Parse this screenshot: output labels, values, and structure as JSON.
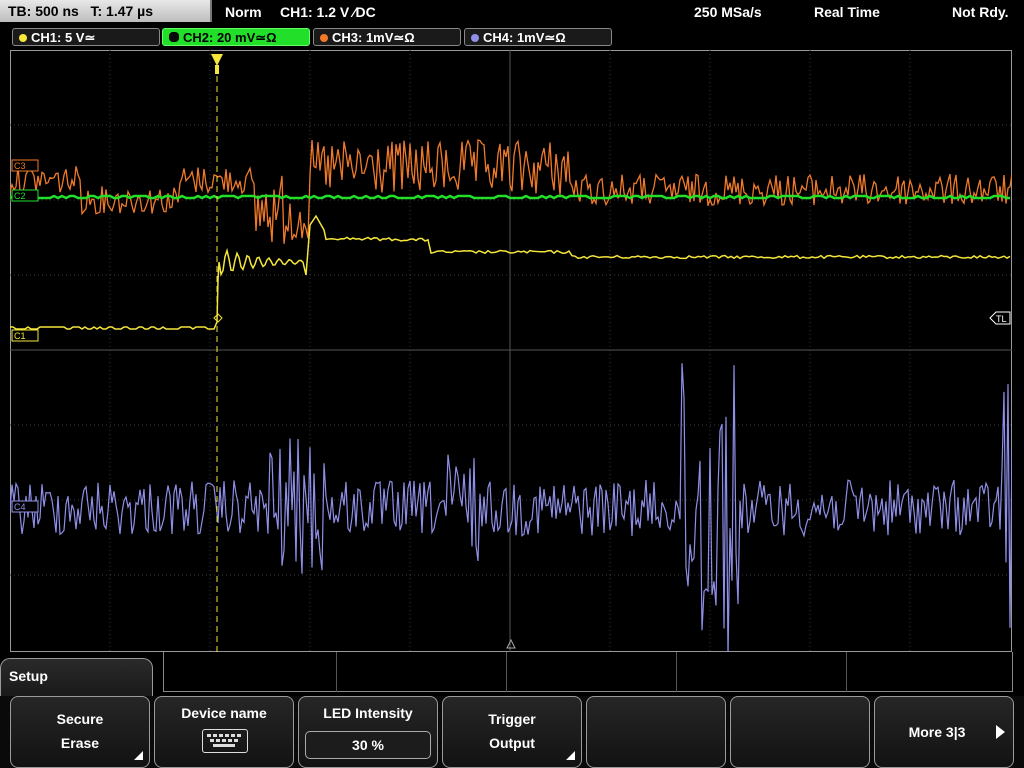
{
  "topbar": {
    "timebase": "TB: 500 ns",
    "trigger_time": "T: 1.47 µs",
    "mode": "Norm",
    "trigger_setting": "CH1: 1.2 V ∕DC",
    "sample_rate": "250 MSa/s",
    "acq_mode": "Real Time",
    "status": "Not Rdy."
  },
  "channels": [
    {
      "label": "CH1: 5 V≃",
      "color": "#f5e63a"
    },
    {
      "label": "CH2: 20 mV≃Ω",
      "color": "#22e02a"
    },
    {
      "label": "CH3: 1mV≃Ω",
      "color": "#f07a2a"
    },
    {
      "label": "CH4: 1mV≃Ω",
      "color": "#8f8fe8"
    }
  ],
  "markers": {
    "c3": "C3",
    "c2": "C2",
    "c1": "C1",
    "c4": "C4",
    "trigger_level": "TL"
  },
  "menu": {
    "title": "Setup",
    "softkeys": [
      {
        "line1": "Secure",
        "line2": "Erase"
      },
      {
        "line1": "Device name",
        "icon": "keyboard-icon"
      },
      {
        "line1": "LED Intensity",
        "value": "30 %"
      },
      {
        "line1": "Trigger",
        "line2": "Output"
      },
      {
        "line1": ""
      },
      {
        "line1": ""
      },
      {
        "line1": "More 3|3"
      }
    ]
  },
  "colors": {
    "ch1": "#f5e63a",
    "ch2": "#22e02a",
    "ch3": "#f07a2a",
    "ch4": "#8f8fe8",
    "grid": "#3a3a3a"
  }
}
